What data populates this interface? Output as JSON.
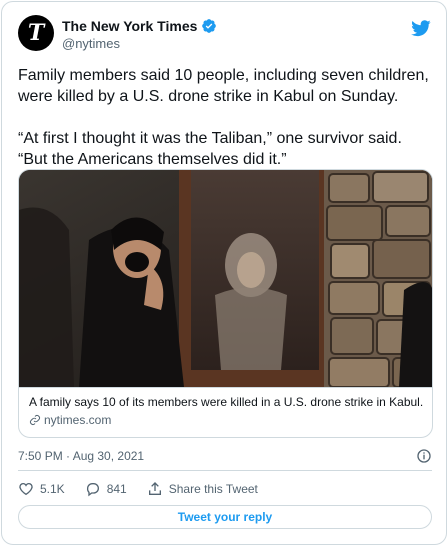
{
  "account": {
    "display_name": "The New York Times",
    "handle": "@nytimes",
    "avatar_letter": "T",
    "verified": true
  },
  "tweet": {
    "paragraph_1": "Family members said 10 people, including seven children, were killed by a U.S. drone strike in Kabul on Sunday.",
    "paragraph_2": "“At first I thought it was the Taliban,” one survivor said. “But the Americans themselves did it.”"
  },
  "link_card": {
    "title": "A family says 10 of its members were killed in a U.S. drone strike in Kabul.",
    "domain": "nytimes.com"
  },
  "meta": {
    "timestamp": "7:50 PM · Aug 30, 2021"
  },
  "actions": {
    "likes": "5.1K",
    "replies": "841",
    "share_label": "Share this Tweet"
  },
  "reply_button": "Tweet your reply",
  "colors": {
    "accent": "#1d9bf0",
    "text": "#0f1419",
    "secondary": "#536471",
    "border": "#cfd9de"
  },
  "icons": [
    "verified-badge-icon",
    "twitter-bird-icon",
    "link-icon",
    "info-icon",
    "heart-icon",
    "reply-icon",
    "share-icon"
  ]
}
